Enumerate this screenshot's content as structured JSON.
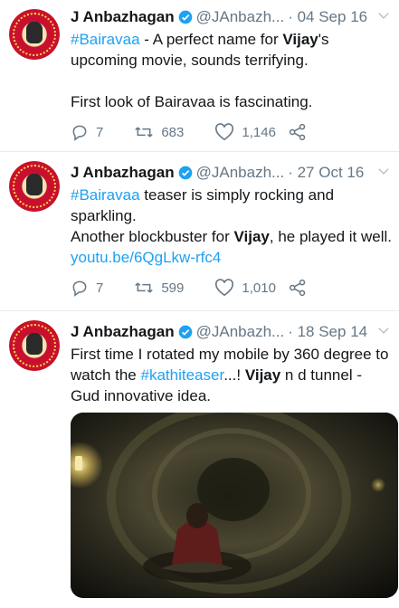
{
  "tweets": [
    {
      "name": "J Anbazhagan",
      "handle": "@JAnbazh...",
      "date": "· 04 Sep 16",
      "hashtag": "#Bairavaa",
      "text_a": " - A perfect name for ",
      "bold": "Vijay",
      "text_b": "'s upcoming movie, sounds terrifying.",
      "line2": "First look of Bairavaa is fascinating.",
      "replies": "7",
      "retweets": "683",
      "likes": "1,146"
    },
    {
      "name": "J Anbazhagan",
      "handle": "@JAnbazh...",
      "date": "· 27 Oct 16",
      "hashtag": "#Bairavaa",
      "text_a": " teaser is simply rocking and sparkling.",
      "line2_a": "Another blockbuster for ",
      "bold": "Vijay",
      "line2_b": ", he played it well. ",
      "link": "youtu.be/6QgLkw-rfc4",
      "replies": "7",
      "retweets": "599",
      "likes": "1,010"
    },
    {
      "name": "J Anbazhagan",
      "handle": "@JAnbazh...",
      "date": "· 18 Sep 14",
      "text_a": "First time I rotated my mobile by 360 degree to watch the ",
      "hashtag": "#kathiteaser",
      "text_b": "...! ",
      "bold": "Vijay",
      "text_c": " n d tunnel - Gud innovative idea."
    }
  ],
  "avatar_badge_text": "LEADERS OF MODERN TAMIL NADU",
  "colors": {
    "link": "#1da1f2",
    "meta": "#657786",
    "text": "#14171a"
  }
}
